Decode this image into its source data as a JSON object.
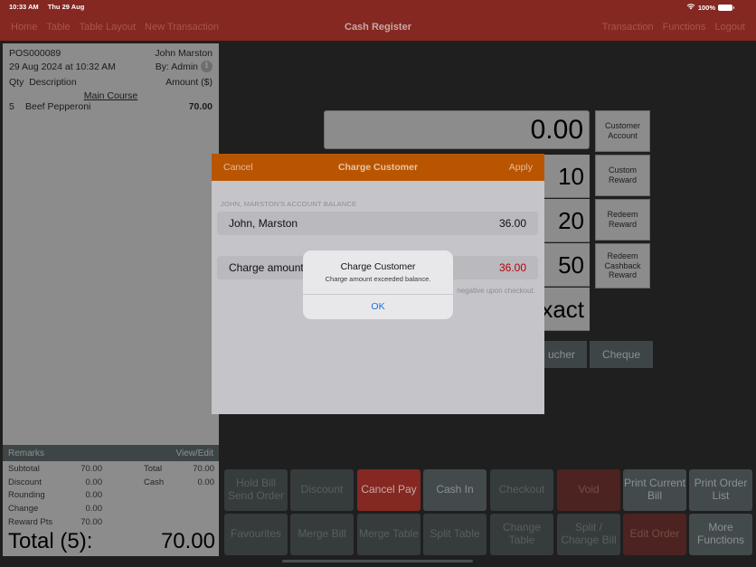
{
  "status_bar": {
    "time": "10:33 AM",
    "date": "Thu 29 Aug",
    "battery": "100%",
    "wifi_icon": "wifi-icon",
    "battery_icon": "battery-icon"
  },
  "nav": {
    "left": [
      "Home",
      "Table",
      "Table Layout",
      "New Transaction"
    ],
    "title": "Cash Register",
    "right": [
      "Transaction",
      "Functions",
      "Logout"
    ]
  },
  "receipt": {
    "order_no": "POS000089",
    "customer": "John Marston",
    "datetime": "29 Aug 2024 at 10:32 AM",
    "by": "By: Admin",
    "info_icon": "info-icon",
    "columns": {
      "qty": "Qty",
      "description": "Description",
      "amount": "Amount ($)"
    },
    "category": "Main Course",
    "items": [
      {
        "qty": "5",
        "description": "Beef Pepperoni",
        "amount": "70.00"
      }
    ],
    "remarks_label": "Remarks",
    "remarks_action": "View/Edit",
    "summary": [
      {
        "label": "Subtotal",
        "value": "70.00",
        "label2": "Total",
        "value2": "70.00"
      },
      {
        "label": "Discount",
        "value": "0.00",
        "label2": "Cash",
        "value2": "0.00"
      },
      {
        "label": "Rounding",
        "value": "0.00",
        "label2": "",
        "value2": ""
      },
      {
        "label": "Change",
        "value": "0.00",
        "label2": "",
        "value2": ""
      },
      {
        "label": "Reward Pts",
        "value": "70.00",
        "label2": "",
        "value2": ""
      }
    ],
    "grand_total_label": "Total (5):",
    "grand_total_value": "70.00"
  },
  "payment": {
    "amount_display": "0.00",
    "quick_cash": [
      "10",
      "20",
      "50",
      "xact"
    ],
    "side_buttons": [
      "Customer Account",
      "Custom Reward",
      "Redeem Reward",
      "Redeem Cashback Reward"
    ],
    "methods": [
      "ucher",
      "Cheque"
    ]
  },
  "functions": {
    "row1": [
      "Hold Bill Send Order",
      "Discount",
      "Cancel Pay",
      "Cash In",
      "Checkout",
      "Void",
      "Print Current Bill",
      "Print Order List"
    ],
    "row2": [
      "Favourites",
      "Merge Bill",
      "Merge Table",
      "Split Table",
      "Change Table",
      "Split / Change Bill",
      "Edit Order",
      "More Functions"
    ]
  },
  "charge_sheet": {
    "cancel": "Cancel",
    "title": "Charge Customer",
    "apply": "Apply",
    "section_label": "JOHN, MARSTON'S ACCOUNT BALANCE",
    "account_name": "John, Marston",
    "account_balance": "36.00",
    "charge_label": "Charge amount",
    "charge_value": "36.00",
    "footnote": "negative upon checkout."
  },
  "alert": {
    "title": "Charge Customer",
    "message": "Charge amount exceeded balance.",
    "ok": "OK"
  },
  "colors": {
    "brand_red": "#842821",
    "sheet_orange": "#b95501",
    "alert_blue": "#1a6fe0",
    "error_red": "#b8000a"
  }
}
